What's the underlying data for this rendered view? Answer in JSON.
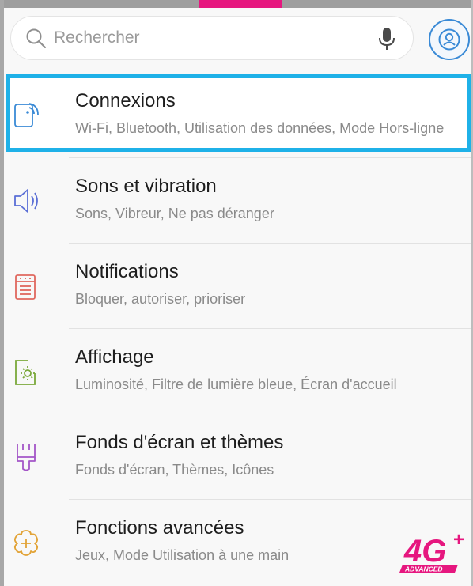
{
  "search": {
    "placeholder": "Rechercher"
  },
  "items": [
    {
      "title": "Connexions",
      "subtitle": "Wi-Fi, Bluetooth, Utilisation des données, Mode Hors-ligne",
      "icon": "wifi-connections-icon",
      "color": "#3a8ad6"
    },
    {
      "title": "Sons et vibration",
      "subtitle": "Sons, Vibreur, Ne pas déranger",
      "icon": "speaker-icon",
      "color": "#5b6fd6"
    },
    {
      "title": "Notifications",
      "subtitle": "Bloquer, autoriser, prioriser",
      "icon": "notifications-icon",
      "color": "#e0685f"
    },
    {
      "title": "Affichage",
      "subtitle": "Luminosité, Filtre de lumière bleue, Écran d'accueil",
      "icon": "display-icon",
      "color": "#7aa83a"
    },
    {
      "title": "Fonds d'écran et thèmes",
      "subtitle": "Fonds d'écran, Thèmes, Icônes",
      "icon": "paintbrush-icon",
      "color": "#a455c7"
    },
    {
      "title": "Fonctions avancées",
      "subtitle": "Jeux, Mode Utilisation à une main",
      "icon": "advanced-features-icon",
      "color": "#e2a336"
    }
  ],
  "badge": {
    "main": "4G",
    "plus": "+",
    "caption": "ADVANCED",
    "color": "#e6177f"
  },
  "colors": {
    "highlight": "#1fb1e8",
    "accent_tab": "#e6177f"
  }
}
